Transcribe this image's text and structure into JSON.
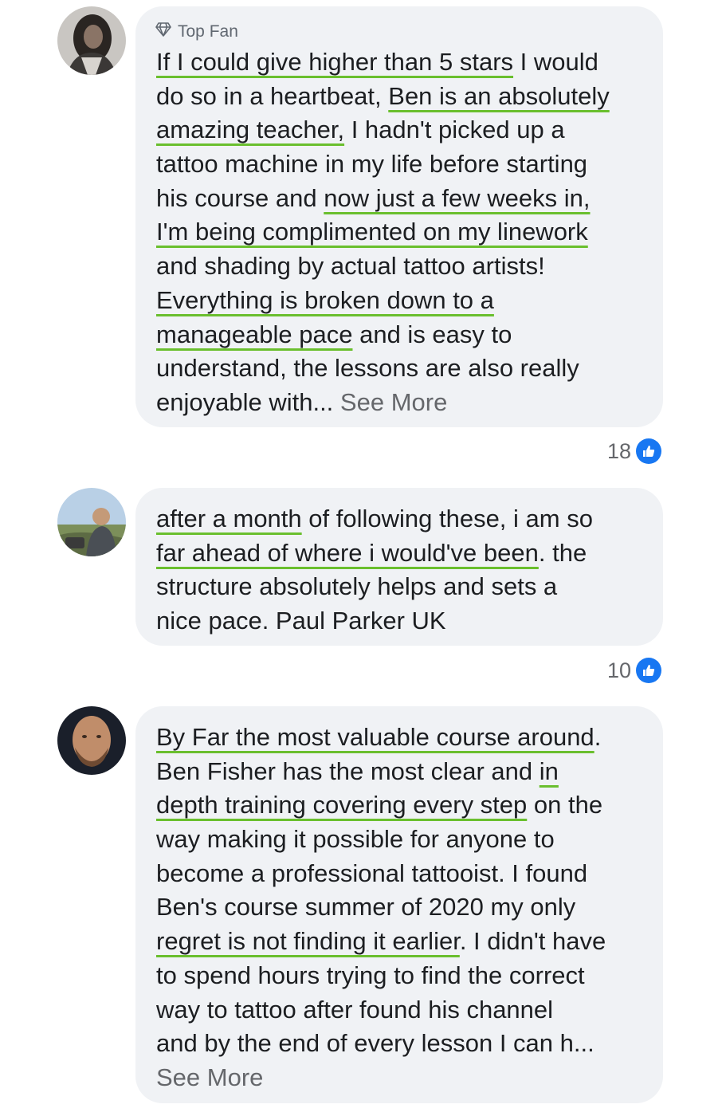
{
  "comments": [
    {
      "badge": "Top Fan",
      "lines": [
        [
          {
            "t": "If I could give higher than 5 stars",
            "hl": true
          },
          {
            "t": " I would"
          }
        ],
        [
          {
            "t": "do so in a heartbeat, "
          },
          {
            "t": "Ben is an absolutely",
            "hl": true
          }
        ],
        [
          {
            "t": "amazing teacher,",
            "hl": true
          },
          {
            "t": " I hadn't picked up a"
          }
        ],
        [
          {
            "t": "tattoo machine in my life before starting"
          }
        ],
        [
          {
            "t": "his course and "
          },
          {
            "t": "now just a few weeks in,",
            "hl": true
          }
        ],
        [
          {
            "t": "I'm being complimented on my linework",
            "hl": true
          }
        ],
        [
          {
            "t": "and shading by actual tattoo artists!"
          }
        ],
        [
          {
            "t": "Everything is broken down to a",
            "hl": true
          }
        ],
        [
          {
            "t": "manageable pace",
            "hl": true
          },
          {
            "t": " and is easy to"
          }
        ],
        [
          {
            "t": "understand, the lessons are also really"
          }
        ],
        [
          {
            "t": "enjoyable with... "
          },
          {
            "t": "See More",
            "muted": true
          }
        ]
      ],
      "reaction_count": "18"
    },
    {
      "lines": [
        [
          {
            "t": "after a month",
            "hl": true
          },
          {
            "t": " of following these, i am so"
          }
        ],
        [
          {
            "t": "far ahead of where i would've been",
            "hl": true
          },
          {
            "t": ". the"
          }
        ],
        [
          {
            "t": "structure absolutely helps and sets a"
          }
        ],
        [
          {
            "t": "nice pace.       Paul Parker UK"
          }
        ]
      ],
      "reaction_count": "10"
    },
    {
      "lines": [
        [
          {
            "t": "By Far the most valuable course around",
            "hl": true
          },
          {
            "t": "."
          }
        ],
        [
          {
            "t": "Ben Fisher has the most clear and "
          },
          {
            "t": "in",
            "hl": true
          }
        ],
        [
          {
            "t": "depth training covering every step",
            "hl": true
          },
          {
            "t": " on the"
          }
        ],
        [
          {
            "t": "way making it possible for anyone to"
          }
        ],
        [
          {
            "t": "become a professional  tattooist. I found"
          }
        ],
        [
          {
            "t": "Ben's course summer of 2020 my only"
          }
        ],
        [
          {
            "t": "regret is not finding it earlier",
            "hl": true
          },
          {
            "t": ". I didn't have"
          }
        ],
        [
          {
            "t": "to spend hours trying to find the correct"
          }
        ],
        [
          {
            "t": "way to tattoo after found his channel"
          }
        ],
        [
          {
            "t": "and by the end of every lesson I can h..."
          }
        ],
        [
          {
            "t": "See More",
            "muted": true
          }
        ]
      ]
    }
  ],
  "icons": {
    "badge": "diamond-icon",
    "reaction": "like-thumb-icon"
  },
  "colors": {
    "bubble": "#f0f2f5",
    "underline": "#6abf2e",
    "like": "#1877f2",
    "muted": "#65676b"
  }
}
